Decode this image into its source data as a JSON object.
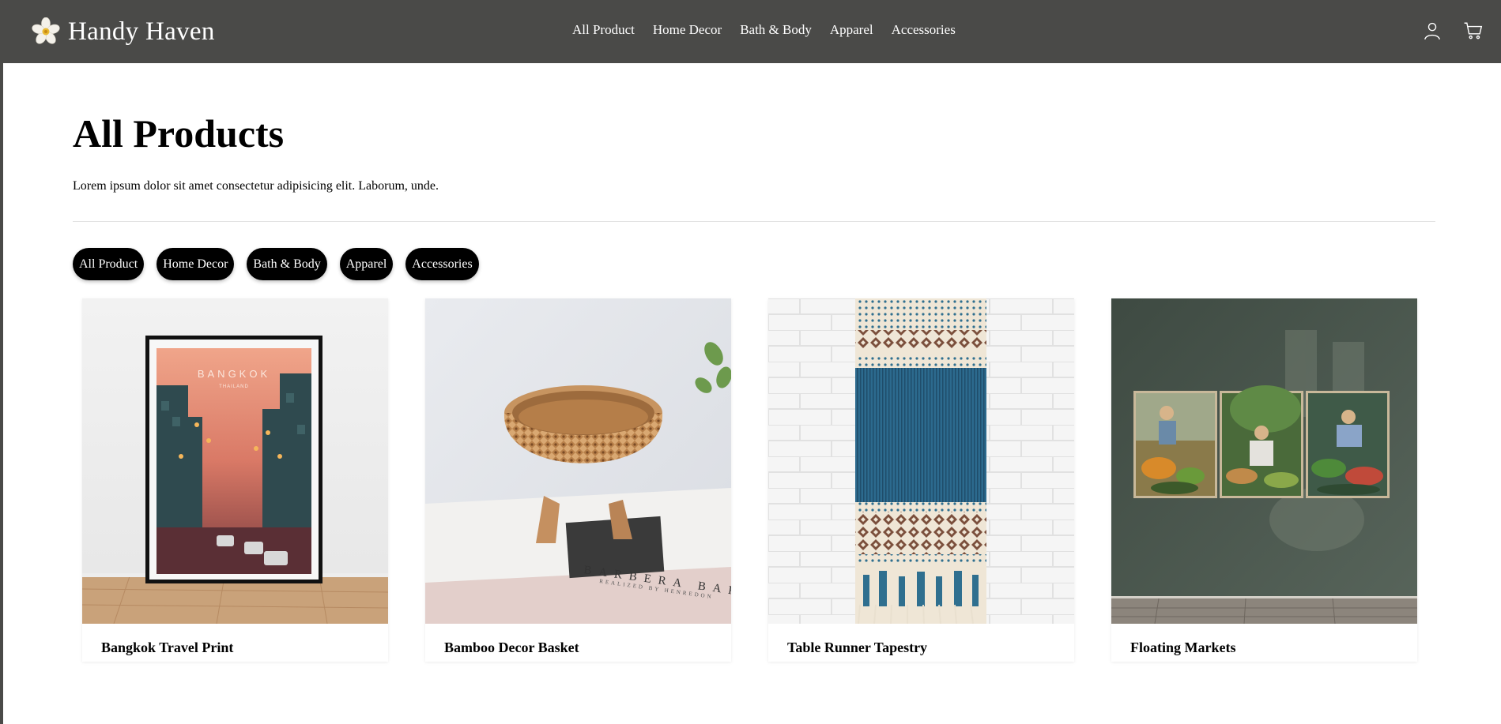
{
  "brand": {
    "name": "Handy Haven",
    "logo_icon": "flower-logo"
  },
  "nav": {
    "items": [
      {
        "label": "All Product"
      },
      {
        "label": "Home Decor"
      },
      {
        "label": "Bath & Body"
      },
      {
        "label": "Apparel"
      },
      {
        "label": "Accessories"
      }
    ]
  },
  "header_icons": [
    "user-icon",
    "cart-icon"
  ],
  "page": {
    "title": "All Products",
    "description": "Lorem ipsum dolor sit amet consectetur adipisicing elit. Laborum, unde."
  },
  "filters": [
    {
      "label": "All Product"
    },
    {
      "label": "Home Decor"
    },
    {
      "label": "Bath & Body"
    },
    {
      "label": "Apparel"
    },
    {
      "label": "Accessories"
    }
  ],
  "products": [
    {
      "name": "Bangkok Travel Print",
      "image_poster_title": "BANGKOK",
      "image_poster_subtitle": "THAILAND"
    },
    {
      "name": "Bamboo Decor Basket",
      "image_book_title": "BARBERA BAREY",
      "image_book_subtitle": "REALIZED BY HENREDON"
    },
    {
      "name": "Table Runner Tapestry"
    },
    {
      "name": "Floating Markets"
    }
  ],
  "colors": {
    "header_bg": "#4a4a48",
    "pill_bg": "#000000",
    "page_bg": "#ffffff"
  }
}
